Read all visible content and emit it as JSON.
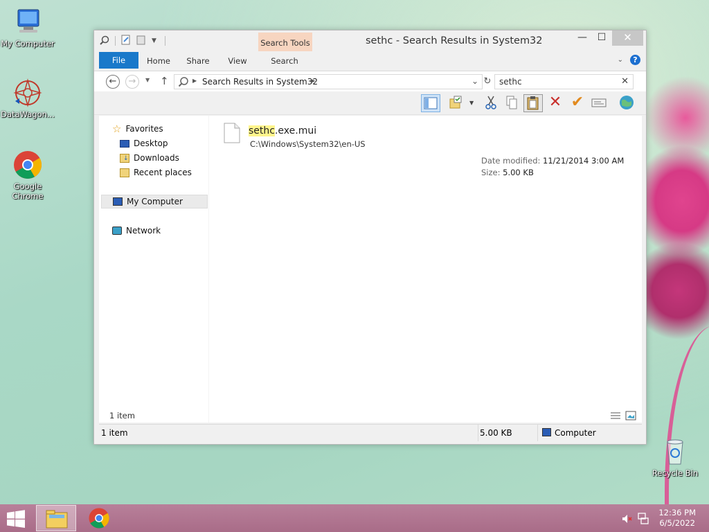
{
  "desktop": {
    "icons": [
      {
        "label": "My Computer"
      },
      {
        "label": "DataWagon..."
      },
      {
        "label": "Google Chrome"
      },
      {
        "label": "Recycle Bin"
      }
    ]
  },
  "window": {
    "title": "sethc - Search Results in System32",
    "context_tab": "Search Tools",
    "tabs": [
      "File",
      "Home",
      "Share",
      "View",
      "Search"
    ],
    "close_symbol": "✕",
    "min_symbol": "—",
    "max_symbol": "☐"
  },
  "address": {
    "breadcrumb": "Search Results in System32",
    "search_value": "sethc"
  },
  "navpane": {
    "favorites": "Favorites",
    "desktop": "Desktop",
    "downloads": "Downloads",
    "recent": "Recent places",
    "computer": "My Computer",
    "network": "Network"
  },
  "results": [
    {
      "name_match": "sethc",
      "name_rest": ".exe.mui",
      "path": "C:\\Windows\\System32\\en-US",
      "date_label": "Date modified:",
      "date_value": "11/21/2014 3:00 AM",
      "size_label": "Size:",
      "size_value": "5.00 KB"
    }
  ],
  "content_footer": "1 item",
  "statusbar": {
    "count": "1 item",
    "size": "5.00 KB",
    "location": "Computer"
  },
  "taskbar": {
    "time": "12:36 PM",
    "date": "6/5/2022"
  },
  "colors": {
    "file_tab": "#1979ca",
    "search_tools_tab": "#f7d5c0",
    "highlight": "#fff58c",
    "taskbar": "#b07590"
  }
}
